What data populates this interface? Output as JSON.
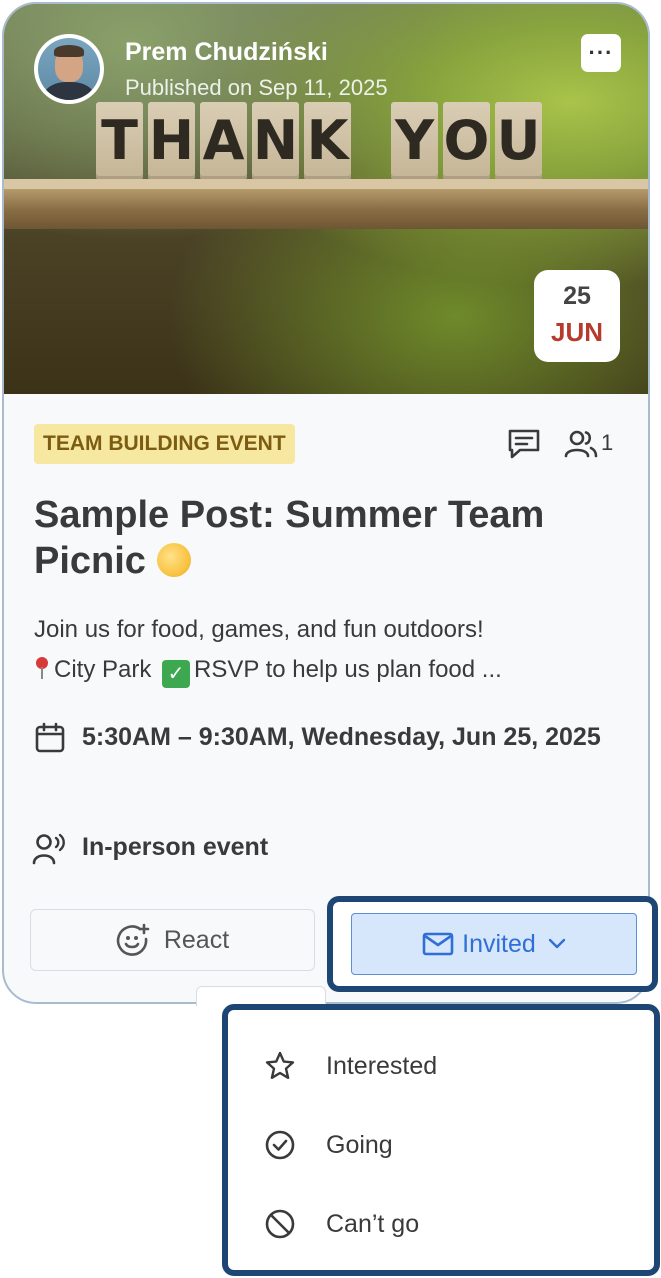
{
  "post": {
    "author_name": "Prem Chudziński",
    "published": "Published on Sep 11, 2025",
    "more_label": "···",
    "hero_word1": [
      "T",
      "H",
      "A",
      "N",
      "K"
    ],
    "hero_word2": [
      "Y",
      "O",
      "U"
    ],
    "date_day": "25",
    "date_month": "JUN",
    "tag": "TEAM BUILDING EVENT",
    "attendee_count": "1",
    "title": "Sample Post: Summer Team Picnic",
    "description_line1": "Join us for food, games, and fun outdoors!",
    "description_location": "City Park",
    "description_rest": "RSVP to help us plan food ...",
    "datetime": "5:30AM – 9:30AM, Wednesday, Jun 25, 2025",
    "event_type": "In-person event"
  },
  "actions": {
    "react_label": "React",
    "invited_label": "Invited"
  },
  "rsvp_menu": {
    "items": [
      {
        "label": "Interested",
        "icon": "star-icon"
      },
      {
        "label": "Going",
        "icon": "check-circle-icon"
      },
      {
        "label": "Can’t go",
        "icon": "ban-icon"
      }
    ]
  },
  "colors": {
    "accent": "#2f6fd6",
    "tag_bg": "#f6e8a0",
    "tag_text": "#7b5c12",
    "date_month": "#b73a2f",
    "highlight_frame": "#1e4674"
  }
}
